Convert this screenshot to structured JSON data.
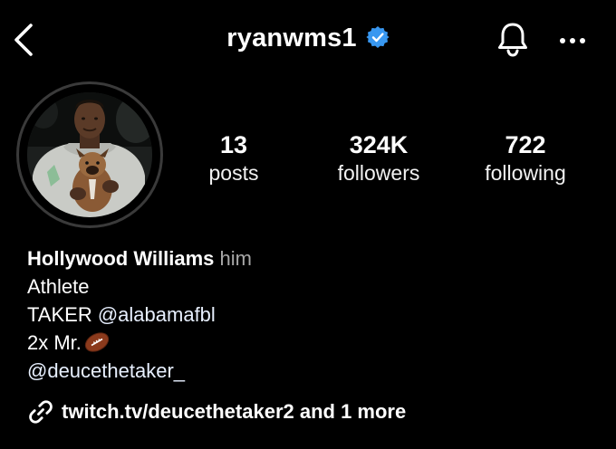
{
  "header": {
    "username": "ryanwms1",
    "verified": true,
    "icons": {
      "back": "back-chevron-icon",
      "verified": "verified-badge-icon",
      "notifications": "bell-icon",
      "more": "more-horizontal-icon"
    }
  },
  "profile": {
    "avatar": "profile-photo-man-holding-puppy"
  },
  "stats": {
    "posts": {
      "count": "13",
      "label": "posts"
    },
    "followers": {
      "count": "324K",
      "label": "followers"
    },
    "following": {
      "count": "722",
      "label": "following"
    }
  },
  "bio": {
    "name": "Hollywood Williams",
    "pronouns": "him",
    "category": "Athlete",
    "line_taker_prefix": "TAKER",
    "line_taker_mention": "@alabamafbl",
    "line_mr": "2x Mr.",
    "line_mr_emoji": "american-football-emoji",
    "handle_mention": "@deucethetaker_"
  },
  "link": {
    "text": "twitch.tv/deucethetaker2 and 1 more",
    "icon": "link-icon"
  },
  "colors": {
    "background": "#000000",
    "text": "#ffffff",
    "secondary": "#a8a8a8",
    "verified": "#3897f0"
  }
}
